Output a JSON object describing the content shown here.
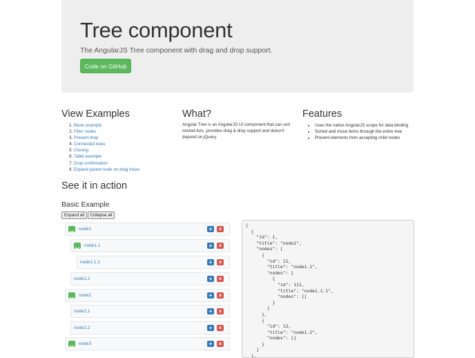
{
  "header": {
    "title": "Tree component",
    "lead": "The AngularJS Tree component with drag and drop support.",
    "github_button": "Code on GitHub"
  },
  "view_examples": {
    "heading": "View Examples",
    "items": [
      "Basic example",
      "Filter nodes",
      "Prevent drop",
      "Connected trees",
      "Cloning",
      "Table example",
      "Drop confirmation",
      "Expand parent node on drag hover"
    ]
  },
  "what": {
    "heading": "What?",
    "text": "Angular Tree is an AngularJS UI component that can sort nested lists, provides drag & drop support and doesn't depend on jQuery."
  },
  "features": {
    "heading": "Features",
    "items": [
      "Uses the native AngularJS scope for data binding",
      "Sorted and move items through the entire tree",
      "Prevent elements from accepting child nodes"
    ]
  },
  "action": {
    "heading": "See it in action",
    "basic_heading": "Basic Example",
    "expand_all": "Expand all",
    "collapse_all": "Collapse all"
  },
  "tree": {
    "nodes": [
      {
        "title": "node1",
        "collapsible": true
      },
      {
        "title": "node1.1",
        "collapsible": true
      },
      {
        "title": "node1.1.1",
        "collapsible": false
      },
      {
        "title": "node1.2",
        "collapsible": false
      },
      {
        "title": "node2",
        "collapsible": true
      },
      {
        "title": "node2.1",
        "collapsible": false
      },
      {
        "title": "node2.2",
        "collapsible": false
      },
      {
        "title": "node3",
        "collapsible": true
      }
    ],
    "add_glyph": "+",
    "remove_glyph": "×"
  },
  "json_view": "[\n  {\n    \"id\": 1,\n    \"title\": \"node1\",\n    \"nodes\": [\n      {\n        \"id\": 11,\n        \"title\": \"node1.1\",\n        \"nodes\": [\n          {\n            \"id\": 111,\n            \"title\": \"node1.1.1\",\n            \"nodes\": []\n          }\n        ]\n      },\n      {\n        \"id\": 12,\n        \"title\": \"node1.2\",\n        \"nodes\": []\n      }\n    ]\n  },",
  "colors": {
    "jumbotron_bg": "#eeeeee",
    "success": "#5cb85c",
    "primary": "#337ab7",
    "danger": "#d9534f",
    "link": "#337ab7"
  }
}
